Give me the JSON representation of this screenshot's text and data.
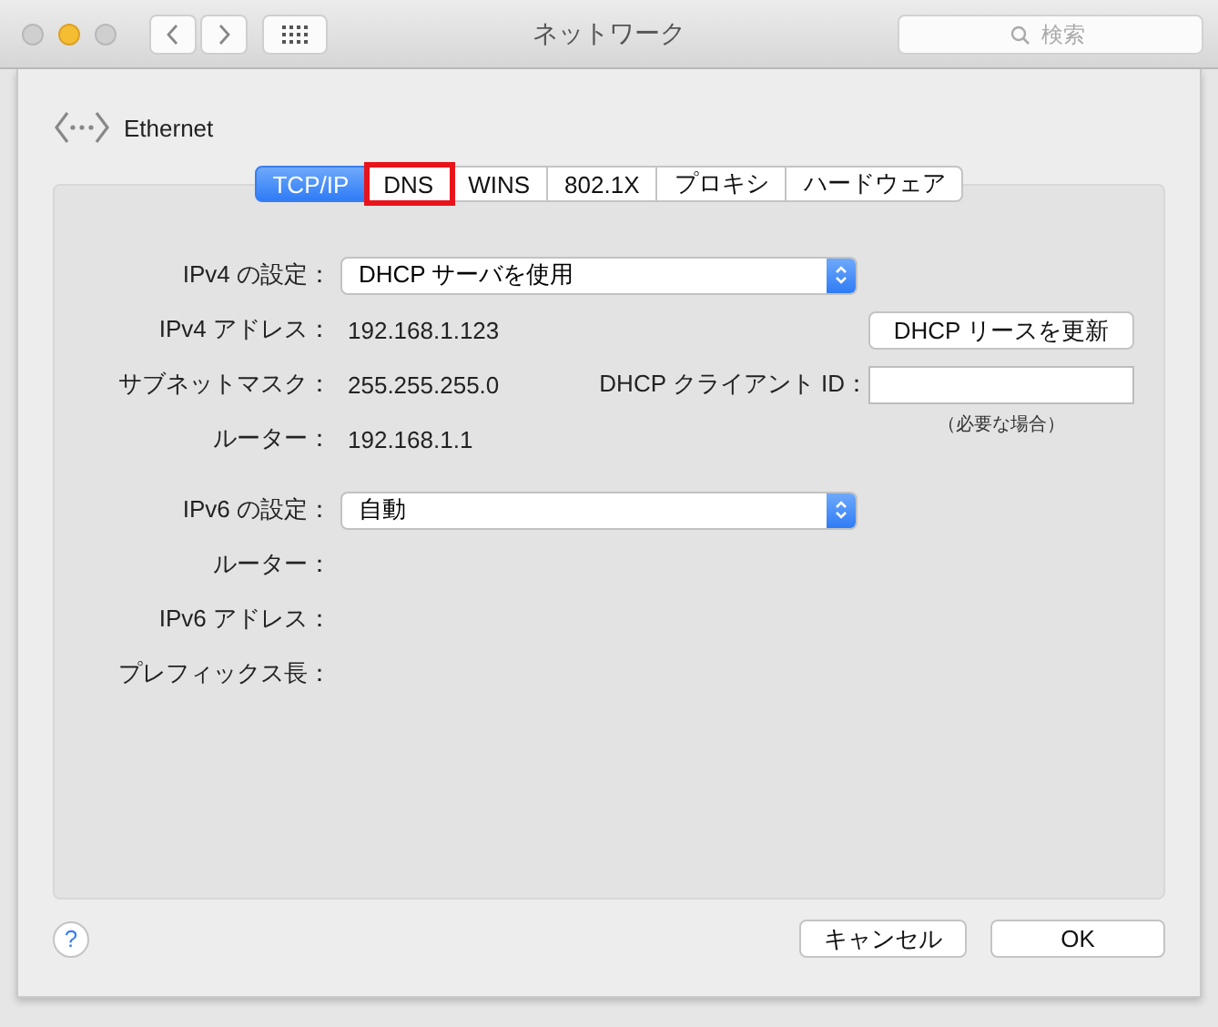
{
  "window": {
    "title": "ネットワーク",
    "search": {
      "placeholder": "検索"
    }
  },
  "service": {
    "name": "Ethernet"
  },
  "tabs": [
    {
      "label": "TCP/IP",
      "selected": true,
      "outlined": false
    },
    {
      "label": "DNS",
      "selected": false,
      "outlined": true
    },
    {
      "label": "WINS",
      "selected": false,
      "outlined": false
    },
    {
      "label": "802.1X",
      "selected": false,
      "outlined": false
    },
    {
      "label": "プロキシ",
      "selected": false,
      "outlined": false
    },
    {
      "label": "ハードウェア",
      "selected": false,
      "outlined": false
    }
  ],
  "ipv4": {
    "label": "IPv4 の設定：",
    "popup": "DHCP サーバを使用",
    "rows": [
      {
        "label": "IPv4 アドレス：",
        "value": "192.168.1.123"
      },
      {
        "label": "サブネットマスク：",
        "value": "255.255.255.0"
      },
      {
        "label": "ルーター：",
        "value": "192.168.1.1"
      }
    ],
    "renew_button": "DHCP リースを更新",
    "client_id": {
      "label": "DHCP クライアント ID：",
      "hint": "（必要な場合）"
    }
  },
  "ipv6": {
    "label": "IPv6 の設定：",
    "popup": "自動",
    "rows": [
      {
        "label": "ルーター："
      },
      {
        "label": "IPv6 アドレス："
      },
      {
        "label": "プレフィックス長："
      }
    ]
  },
  "help": "?",
  "buttons": [
    {
      "label": "キャンセル"
    },
    {
      "label": "OK"
    }
  ]
}
